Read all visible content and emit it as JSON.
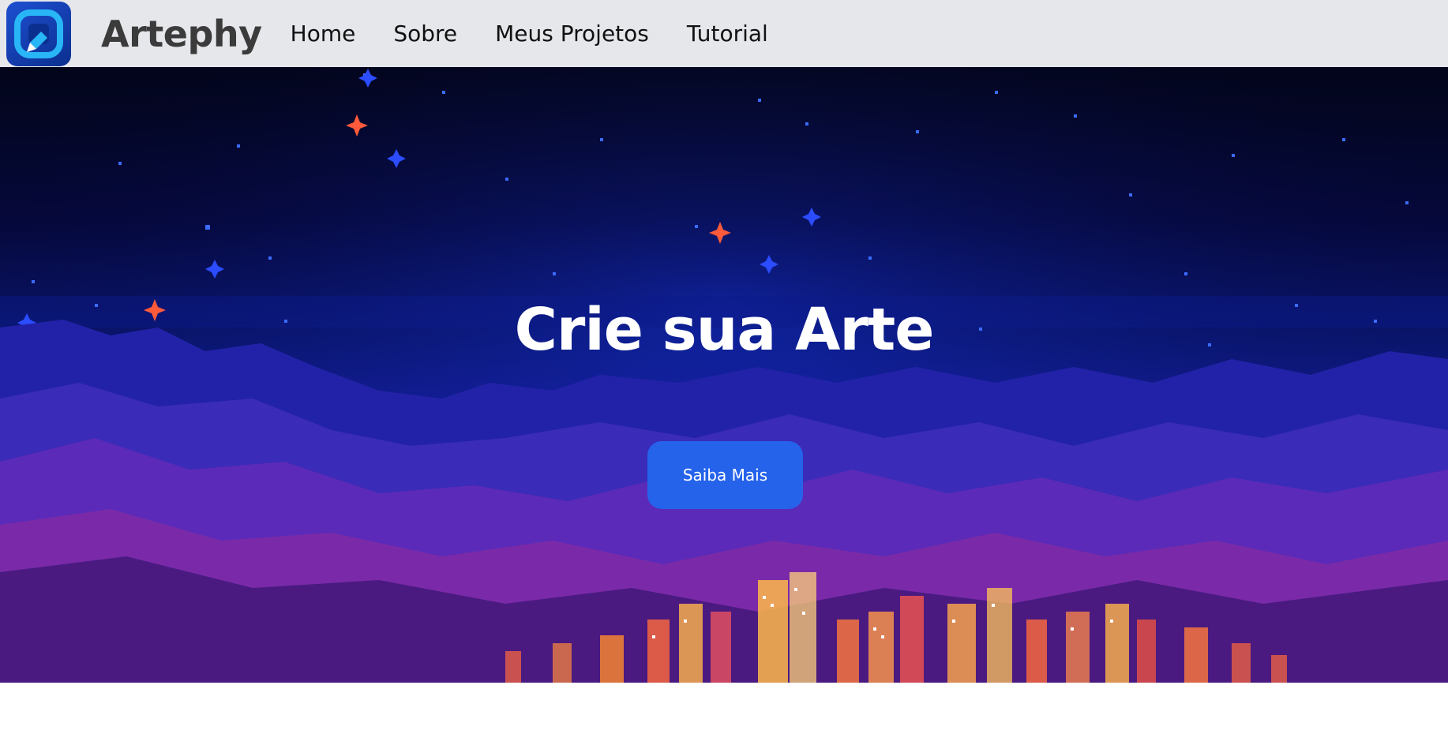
{
  "brand": {
    "name": "Artephy",
    "logo_icon": "artephy-logo-icon",
    "logo_color": "#1e4fd1"
  },
  "nav": {
    "items": [
      {
        "label": "Home"
      },
      {
        "label": "Sobre"
      },
      {
        "label": "Meus Projetos"
      },
      {
        "label": "Tutorial"
      }
    ],
    "background": "#e5e7eb"
  },
  "hero": {
    "title": "Crie sua Arte",
    "button_label": "Saiba Mais",
    "button_color": "#2563eb",
    "background_image": "pixel-art-night-city-skyline"
  }
}
